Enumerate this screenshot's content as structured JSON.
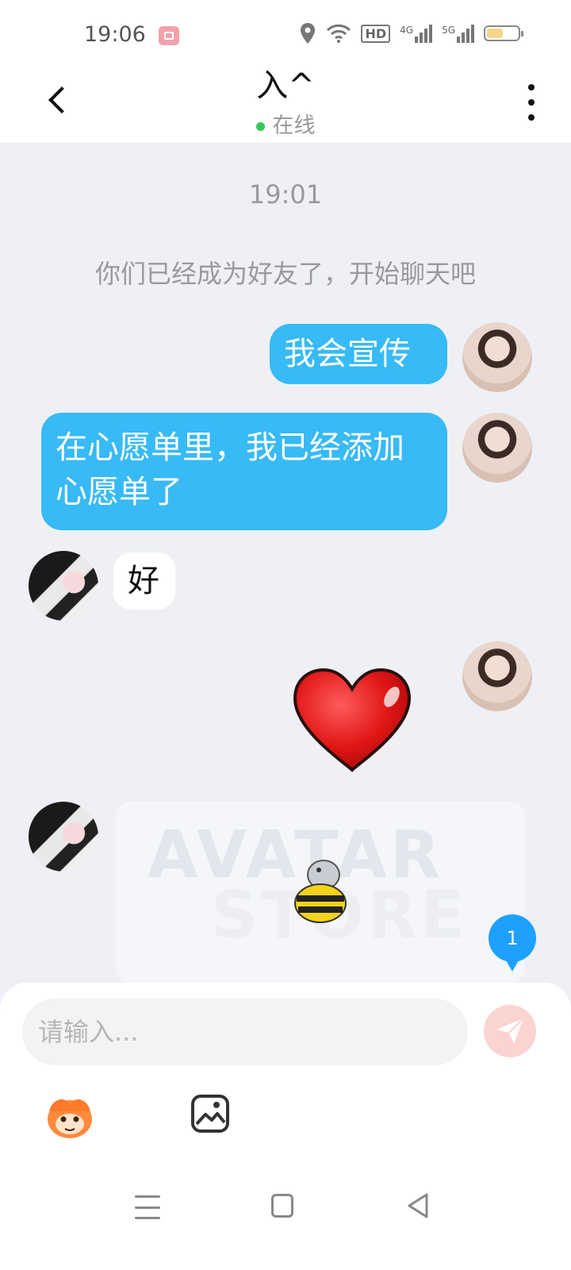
{
  "status_bar": {
    "time": "19:06",
    "icons": [
      "screen-record-icon",
      "location-icon",
      "wifi-icon",
      "hd-icon",
      "signal-4g-icon",
      "signal-5g-icon",
      "battery-icon"
    ],
    "signal_4g": "4G",
    "signal_5g": "5G",
    "hd": "HD"
  },
  "header": {
    "title": "入^",
    "status": "在线",
    "online_color": "#34c759"
  },
  "chat": {
    "timestamp": "19:01",
    "system_message": "你们已经成为好友了，开始聊天吧",
    "messages": [
      {
        "from": "me",
        "type": "text",
        "text": "我会宣传"
      },
      {
        "from": "me",
        "type": "text",
        "text": "在心愿单里，我已经添加心愿单了"
      },
      {
        "from": "friend",
        "type": "text",
        "text": "好"
      },
      {
        "from": "me",
        "type": "sticker",
        "sticker": "red-heart"
      },
      {
        "from": "friend",
        "type": "card",
        "card_title_line1": "AVATAR",
        "card_title_line2": "STORE"
      }
    ],
    "unread_count": "1"
  },
  "composer": {
    "placeholder": "请输入..."
  },
  "colors": {
    "bubble_out": "#37baf6",
    "background": "#eef0f5",
    "badge": "#1ea0ff"
  }
}
